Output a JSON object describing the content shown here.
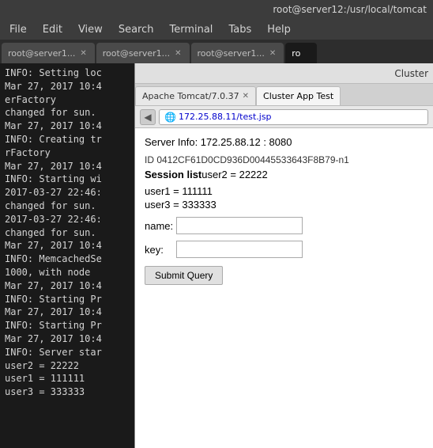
{
  "titleBar": {
    "text": "root@server12:/usr/local/tomcat"
  },
  "menuBar": {
    "items": [
      "File",
      "Edit",
      "View",
      "Search",
      "Terminal",
      "Tabs",
      "Help"
    ]
  },
  "terminalTabs": [
    {
      "label": "root@server1...",
      "active": false
    },
    {
      "label": "root@server1...",
      "active": false
    },
    {
      "label": "root@server1...",
      "active": false
    },
    {
      "label": "ro",
      "active": true,
      "partial": true
    }
  ],
  "terminalContent": [
    "INFO: Setting loc",
    "Mar 27, 2017 10:4",
    "erFactory",
    " changed for sun.",
    "Mar 27, 2017 10:4",
    "INFO: Creating tr",
    "rFactory",
    "Mar 27, 2017 10:4",
    "INFO: Starting wi",
    "2017-03-27 22:46:",
    " changed for sun.",
    "2017-03-27 22:46:",
    " changed for sun.",
    "Mar 27, 2017 10:4",
    "INFO: MemcachedSe",
    " 1000, with node",
    "Mar 27, 2017 10:4",
    "INFO: Starting Pr",
    "Mar 27, 2017 10:4",
    "INFO: Starting Pr",
    "Mar 27, 2017 10:4",
    "INFO: Server star",
    "user2 = 22222",
    "user1 = 111111",
    "user3 = 333333"
  ],
  "browserChrome": {
    "titleText": "Cluster"
  },
  "browserTabs": [
    {
      "label": "Apache Tomcat/7.0.37",
      "active": false
    },
    {
      "label": "Cluster App Test",
      "active": true
    }
  ],
  "addressBar": {
    "url": "172.25.88.11/test.jsp"
  },
  "browserContent": {
    "serverInfo": "Server Info: 172.25.88.12 : 8080",
    "sessionId": "ID 0412CF61D0CD936D00445533643F8B79-n1",
    "sessionListLabel": "Session list",
    "user2": "user2 = 22222",
    "user1": "user1 = 111111",
    "user3": "user3 = 333333",
    "nameLabel": "name:",
    "keyLabel": "key:",
    "submitLabel": "Submit Query"
  }
}
